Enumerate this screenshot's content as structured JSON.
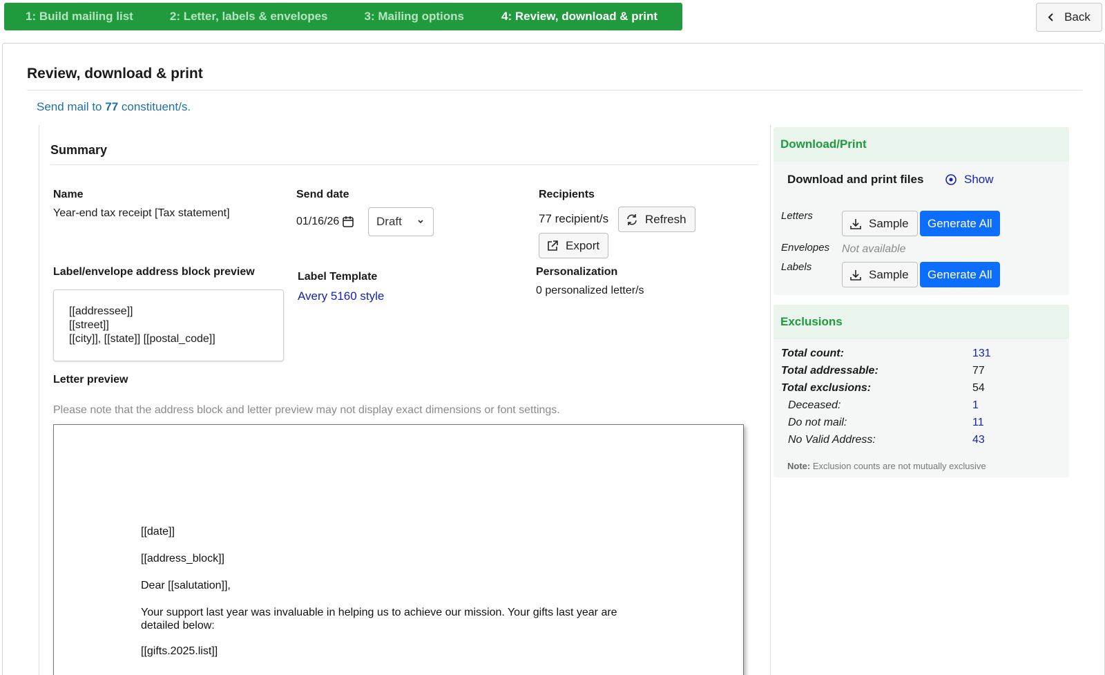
{
  "steps": [
    {
      "label": "1: Build mailing list",
      "active": false
    },
    {
      "label": "2: Letter, labels & envelopes",
      "active": false
    },
    {
      "label": "3: Mailing options",
      "active": false
    },
    {
      "label": "4: Review, download & print",
      "active": true
    }
  ],
  "back_label": "Back",
  "page_title": "Review, download & print",
  "send_line": {
    "prefix": "Send mail to ",
    "count": "77",
    "suffix": " constituent/s."
  },
  "summary": {
    "title": "Summary",
    "name_label": "Name",
    "name_value": "Year-end tax receipt [Tax statement]",
    "send_date_label": "Send date",
    "send_date_value": "01/16/26",
    "status_value": "Draft",
    "recipients_label": "Recipients",
    "recipients_value": "77 recipient/s",
    "refresh_label": "Refresh",
    "export_label": "Export",
    "address_block_label": "Label/envelope address block preview",
    "address_lines": [
      "[[addressee]]",
      "[[street]]",
      "[[city]], [[state]] [[postal_code]]"
    ],
    "label_template_label": "Label Template",
    "label_template_value": "Avery 5160 style",
    "personalization_label": "Personalization",
    "personalization_value": "0 personalized letter/s",
    "letter_preview_label": "Letter preview",
    "letter_preview_note": "Please note that the address block and letter preview may not display exact dimensions or font settings.",
    "letter_lines": [
      "[[date]]",
      "[[address_block]]",
      "Dear [[salutation]],",
      "Your support last year was invaluable in helping us to achieve our mission. Your gifts last year are",
      "detailed below:",
      "[[gifts.2025.list]]"
    ]
  },
  "download": {
    "title": "Download/Print",
    "files_label": "Download and print files",
    "show_label": "Show",
    "letters_label": "Letters",
    "envelopes_label": "Envelopes",
    "labels_label": "Labels",
    "sample_label": "Sample",
    "generate_label": "Generate All",
    "not_available": "Not available"
  },
  "exclusions": {
    "title": "Exclusions",
    "rows": [
      {
        "label": "Total count:",
        "value": "131",
        "linked": true
      },
      {
        "label": "Total addressable:",
        "value": "77",
        "linked": false
      },
      {
        "label": "Total exclusions:",
        "value": "54",
        "linked": false
      },
      {
        "label": "Deceased:",
        "value": "1",
        "linked": true
      },
      {
        "label": "Do not mail:",
        "value": "11",
        "linked": true
      },
      {
        "label": "No Valid Address:",
        "value": "43",
        "linked": true
      }
    ],
    "note_prefix": "Note:",
    "note_text": " Exclusion counts are not mutually exclusive"
  },
  "colors": {
    "brand_green": "#1f9a3d",
    "primary_blue": "#0d6efd",
    "link_blue": "#1422b8",
    "send_line_blue": "#1f6fa8"
  },
  "icons": [
    "chevron-left-icon",
    "calendar-icon",
    "chevron-down-icon",
    "refresh-icon",
    "external-link-icon",
    "eye-icon",
    "download-icon"
  ]
}
